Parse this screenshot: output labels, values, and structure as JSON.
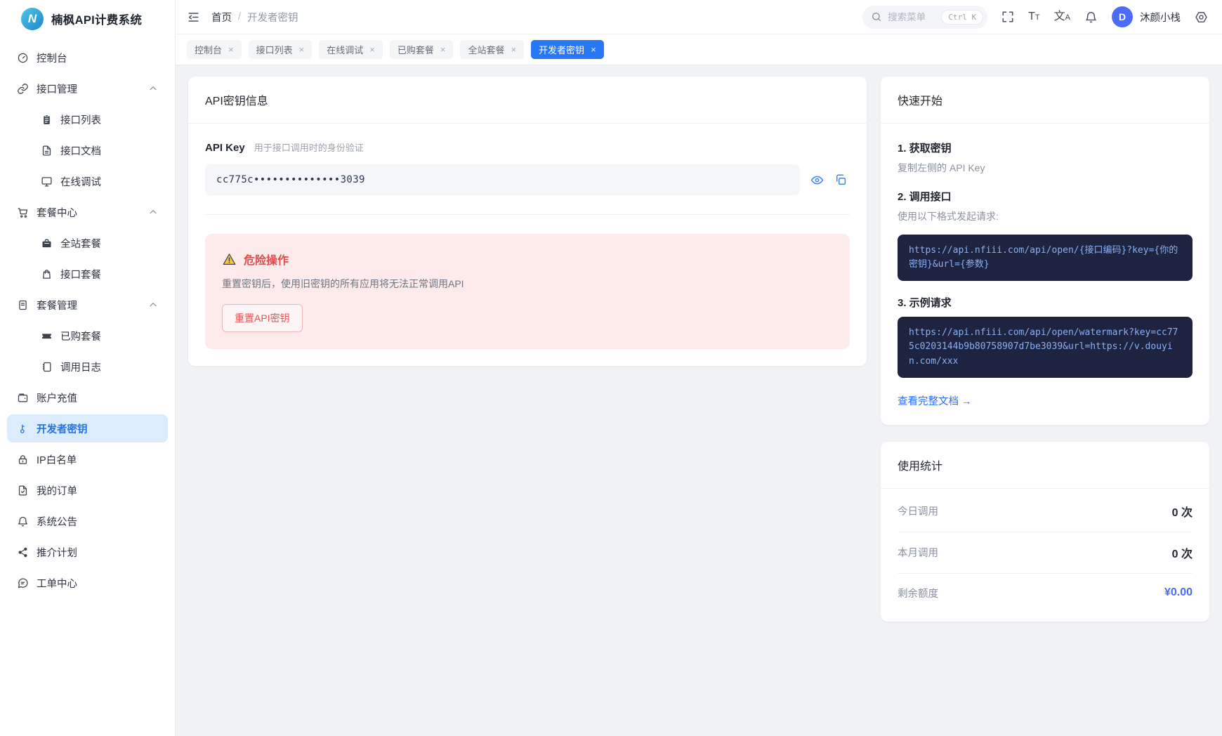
{
  "app": {
    "title": "楠枫API计费系统",
    "logo_initial": "N"
  },
  "header": {
    "breadcrumb": {
      "home": "首页",
      "separator": "/",
      "current": "开发者密钥"
    },
    "search": {
      "placeholder": "搜索菜单",
      "shortcut": "Ctrl K"
    },
    "icons": {
      "text_size_primary": "T",
      "text_size_secondary": "T",
      "translate_primary": "文",
      "translate_secondary": "A"
    },
    "user": {
      "avatar_initial": "D",
      "name": "沐颜小栈"
    }
  },
  "ui": {
    "close_glyph": "×"
  },
  "tabs": [
    {
      "label": "控制台"
    },
    {
      "label": "接口列表"
    },
    {
      "label": "在线调试"
    },
    {
      "label": "已购套餐"
    },
    {
      "label": "全站套餐"
    },
    {
      "label": "开发者密钥",
      "active": true
    }
  ],
  "sidebar": {
    "items": [
      {
        "label": "控制台",
        "icon": "dashboard-icon"
      },
      {
        "label": "接口管理",
        "icon": "link-icon",
        "expanded": true
      },
      {
        "label": "接口列表",
        "icon": "clipboard-icon",
        "child": true
      },
      {
        "label": "接口文档",
        "icon": "document-icon",
        "child": true
      },
      {
        "label": "在线调试",
        "icon": "monitor-icon",
        "child": true
      },
      {
        "label": "套餐中心",
        "icon": "cart-icon",
        "expanded": true
      },
      {
        "label": "全站套餐",
        "icon": "briefcase-icon",
        "child": true
      },
      {
        "label": "接口套餐",
        "icon": "shopping-bag-icon",
        "child": true
      },
      {
        "label": "套餐管理",
        "icon": "file-lines-icon",
        "expanded": true
      },
      {
        "label": "已购套餐",
        "icon": "ticket-icon",
        "child": true
      },
      {
        "label": "调用日志",
        "icon": "notebook-icon",
        "child": true
      },
      {
        "label": "账户充值",
        "icon": "wallet-icon"
      },
      {
        "label": "开发者密钥",
        "icon": "key-icon",
        "active": true
      },
      {
        "label": "IP白名单",
        "icon": "lock-icon"
      },
      {
        "label": "我的订单",
        "icon": "order-icon"
      },
      {
        "label": "系统公告",
        "icon": "bell-icon"
      },
      {
        "label": "推介计划",
        "icon": "share-icon"
      },
      {
        "label": "工单中心",
        "icon": "chat-icon"
      }
    ]
  },
  "api_key_card": {
    "title": "API密钥信息",
    "key_label": "API Key",
    "key_hint": "用于接口调用时的身份验证",
    "key_masked": "cc775c••••••••••••••3039",
    "danger": {
      "title": "危险操作",
      "description": "重置密钥后，使用旧密钥的所有应用将无法正常调用API",
      "reset_button": "重置API密钥"
    }
  },
  "quickstart_card": {
    "title": "快速开始",
    "steps": [
      {
        "title": "1. 获取密钥",
        "description": "复制左侧的 API Key"
      },
      {
        "title": "2. 调用接口",
        "description": "使用以下格式发起请求:",
        "code": "https://api.nfiii.com/api/open/{接口编码}?key={你的密钥}&url={参数}"
      },
      {
        "title": "3. 示例请求",
        "code": "https://api.nfiii.com/api/open/watermark?key=cc775c0203144b9b80758907d7be3039&url=https://v.douyin.com/xxx"
      }
    ],
    "docs_link": "查看完整文档 →"
  },
  "stats_card": {
    "title": "使用统计",
    "rows": [
      {
        "label": "今日调用",
        "value": "0 次"
      },
      {
        "label": "本月调用",
        "value": "0 次"
      },
      {
        "label": "剩余额度",
        "value": "¥0.00",
        "highlight": true
      }
    ]
  },
  "colors": {
    "primary_blue": "#2878f6",
    "sidebar_active_bg": "#dcecfd",
    "sidebar_active_text": "#2372e5",
    "danger_red": "#e14b4b",
    "danger_bg": "#fcebea",
    "code_bg": "#1e2340",
    "code_text": "#8ab0f5",
    "balance_blue": "#4a6af5",
    "avatar_bg": "#4a6cf7"
  }
}
